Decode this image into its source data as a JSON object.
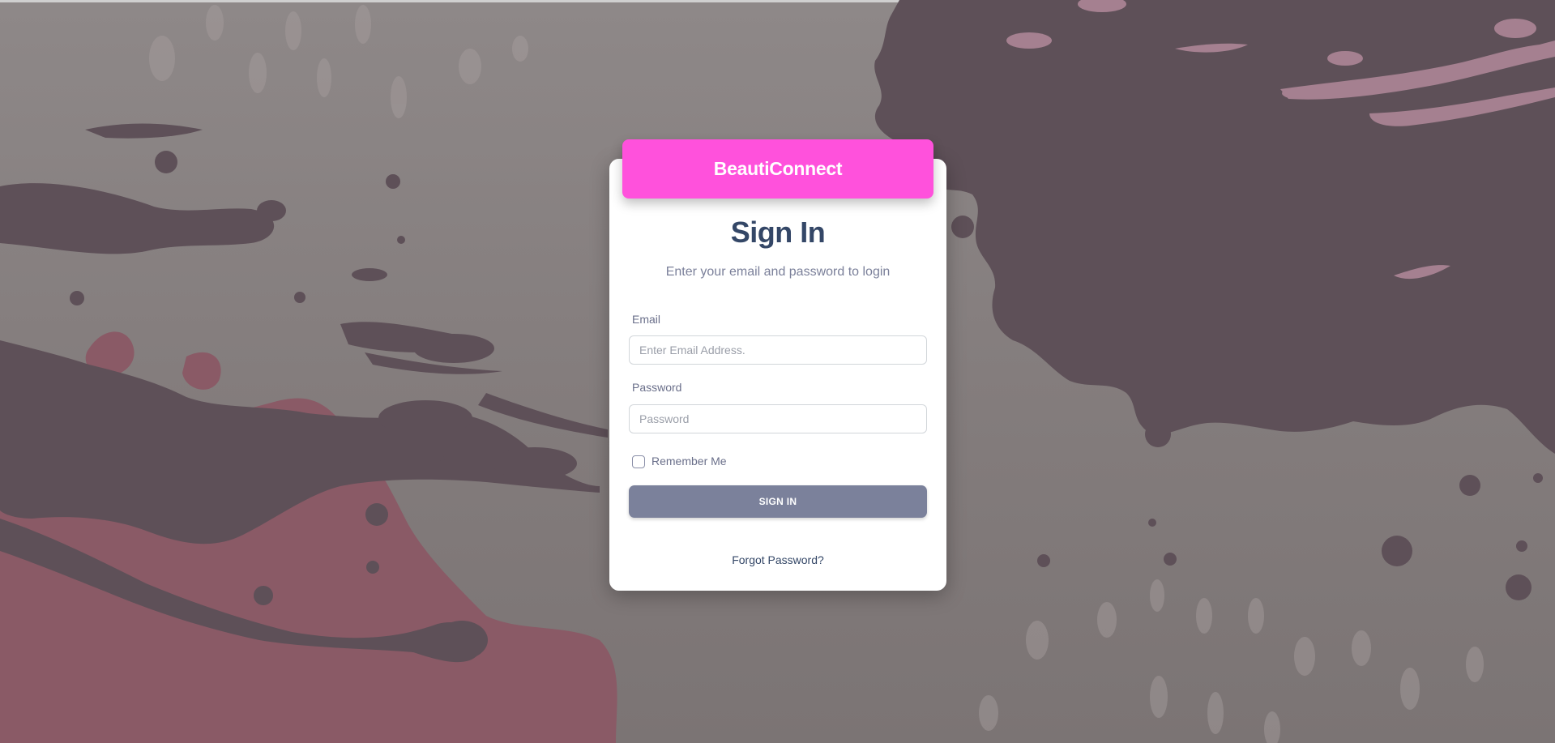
{
  "brand": {
    "name": "BeautiConnect"
  },
  "form": {
    "title": "Sign In",
    "subtitle": "Enter your email and password to login",
    "email": {
      "label": "Email",
      "placeholder": "Enter Email Address.",
      "value": ""
    },
    "password": {
      "label": "Password",
      "placeholder": "Password",
      "value": ""
    },
    "remember_label": "Remember Me",
    "remember_checked": false,
    "submit_label": "SIGN IN",
    "forgot_label": "Forgot Password?"
  },
  "colors": {
    "brand": "#ff51dc",
    "button": "#7b819b",
    "heading": "#344767",
    "muted": "#7b809a",
    "splatter_dark": "#5e5058",
    "splatter_rose": "#8a5a66",
    "splatter_pink": "#a58090"
  },
  "icons": {
    "background": "paint-splatter-background"
  }
}
